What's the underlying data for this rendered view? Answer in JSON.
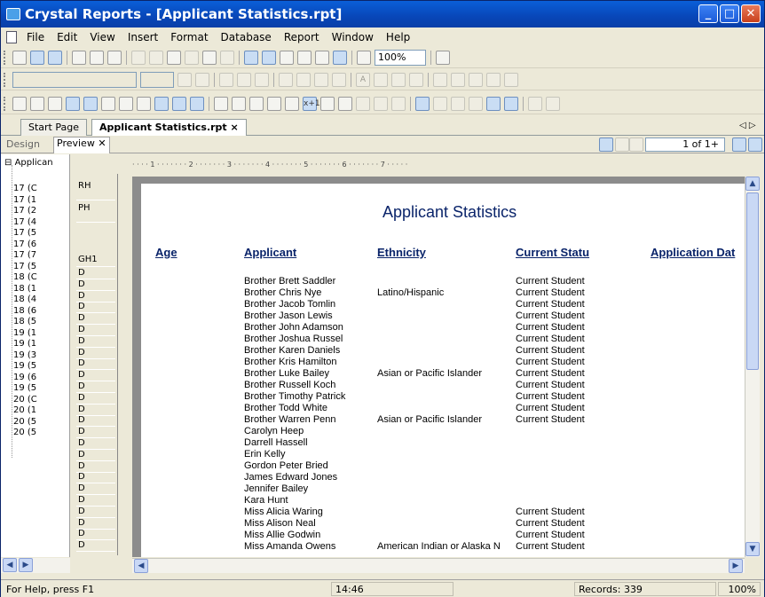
{
  "window": {
    "title": "Crystal Reports - [Applicant Statistics.rpt]",
    "min": "_",
    "max": "□",
    "close": "✕"
  },
  "menu": [
    "File",
    "Edit",
    "View",
    "Insert",
    "Format",
    "Database",
    "Report",
    "Window",
    "Help"
  ],
  "toolbar1": {
    "zoom": "100%"
  },
  "toolbar2": {
    "font_color": "A"
  },
  "toolbar3": {
    "formula": "x+1"
  },
  "tabs": [
    "Start Page",
    "Applicant Statistics.rpt"
  ],
  "tab_close": "×",
  "tab_nav": "◁ ▷",
  "view": {
    "design": "Design",
    "preview": "Preview",
    "preview_close": "✕",
    "page": "1 of 1+"
  },
  "tree": {
    "root": "Applican",
    "expander": "⊟",
    "nodes": [
      "17 (C",
      "17 (1",
      "17 (2",
      "17 (4",
      "17 (5",
      "17 (6",
      "17 (7",
      "17 (5",
      "18 (C",
      "18 (1",
      "18 (4",
      "18 (6",
      "18 (5",
      "19 (1",
      "19 (1",
      "19 (3",
      "19 (5",
      "19 (6",
      "19 (5",
      "20 (C",
      "20 (1",
      "20 (5",
      "20 (5"
    ]
  },
  "sections": {
    "rh": "RH",
    "ph": "PH",
    "gh1": "GH1",
    "detail": "D",
    "detail_count": 25
  },
  "ruler": "· · · · 1 · · · · · · · 2 · · · · · · · 3 · · · · · · · 4 · · · · · · · 5 · · · · · · · 6 · · · · · · · 7 · · · · ·",
  "report": {
    "title": "Applicant Statistics",
    "headers": [
      "Age",
      "Applicant",
      "Ethnicity",
      "Current Statu",
      "Application Dat"
    ],
    "rows": [
      [
        "Brother Brett Saddler",
        "",
        "Current Student"
      ],
      [
        "Brother Chris Nye",
        "Latino/Hispanic",
        "Current Student"
      ],
      [
        "Brother Jacob Tomlin",
        "",
        "Current Student"
      ],
      [
        "Brother Jason Lewis",
        "",
        "Current Student"
      ],
      [
        "Brother John Adamson",
        "",
        "Current Student"
      ],
      [
        "Brother Joshua Russel",
        "",
        "Current Student"
      ],
      [
        "Brother Karen Daniels",
        "",
        "Current Student"
      ],
      [
        "Brother Kris Hamilton",
        "",
        "Current Student"
      ],
      [
        "Brother Luke Bailey",
        "Asian or Pacific Islander",
        "Current Student"
      ],
      [
        "Brother Russell Koch",
        "",
        "Current Student"
      ],
      [
        "Brother Timothy Patrick",
        "",
        "Current Student"
      ],
      [
        "Brother Todd White",
        "",
        "Current Student"
      ],
      [
        "Brother Warren Penn",
        "Asian or Pacific Islander",
        "Current Student"
      ],
      [
        "Carolyn Heep",
        "",
        ""
      ],
      [
        "Darrell Hassell",
        "",
        ""
      ],
      [
        "Erin Kelly",
        "",
        ""
      ],
      [
        "Gordon Peter Bried",
        "",
        ""
      ],
      [
        "James Edward Jones",
        "",
        ""
      ],
      [
        "Jennifer Bailey",
        "",
        ""
      ],
      [
        "Kara Hunt",
        "",
        ""
      ],
      [
        "Miss Alicia Waring",
        "",
        "Current Student"
      ],
      [
        "Miss Alison Neal",
        "",
        "Current Student"
      ],
      [
        "Miss Allie Godwin",
        "",
        "Current Student"
      ],
      [
        "Miss Amanda Owens",
        "American Indian or Alaska N",
        "Current Student"
      ]
    ]
  },
  "status": {
    "help": "For Help, press F1",
    "time": "14:46",
    "records": "Records: 339",
    "zoom": "100%"
  }
}
